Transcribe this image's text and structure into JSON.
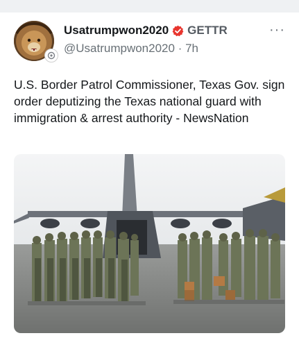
{
  "author": {
    "display_name": "Usatrumpwon2020",
    "platform": "GETTR",
    "handle": "@Usatrumpwon2020",
    "separator": "·",
    "time": "7h"
  },
  "post": {
    "text": "U.S. Border Patrol Commissioner, Texas Gov. sign order deputizing the Texas national guard with immigration & arrest authority - NewsNation"
  },
  "icons": {
    "verified": "verified-badge-icon",
    "more": "more-options-icon"
  },
  "colors": {
    "verified": "#e8352e",
    "text": "#14171a",
    "secondary": "#687076"
  }
}
